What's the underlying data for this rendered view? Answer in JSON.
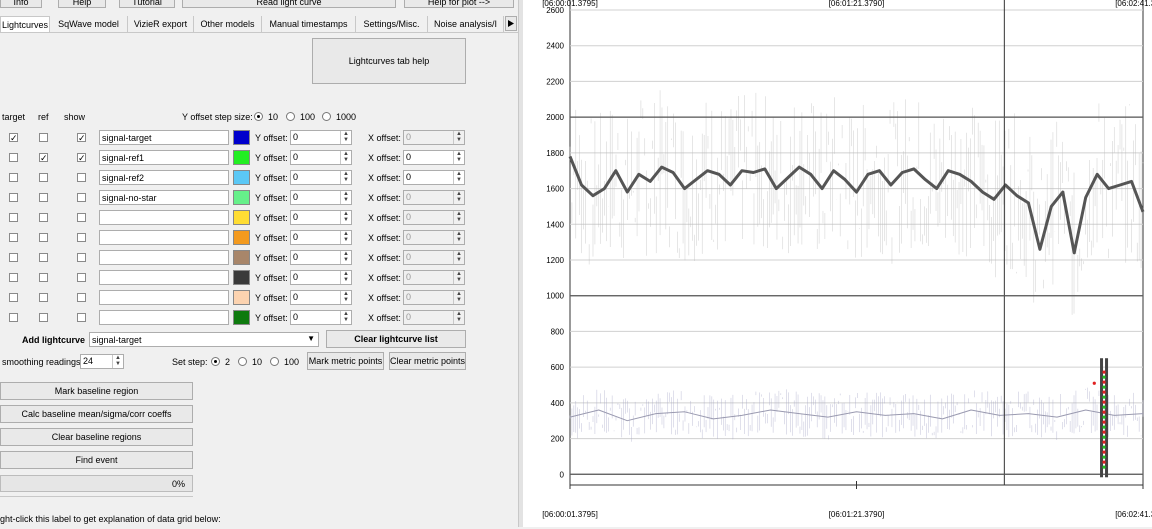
{
  "toolbar": {
    "info_label": "Info",
    "help_label": "Help",
    "tutorial_label": "Tutorial",
    "read_lc_label": "Read light curve",
    "help_plot_label": "Help for plot -->"
  },
  "tabs": [
    {
      "label": "Lightcurves"
    },
    {
      "label": "SqWave model"
    },
    {
      "label": "VizieR export"
    },
    {
      "label": "Other models"
    },
    {
      "label": "Manual timestamps"
    },
    {
      "label": "Settings/Misc."
    },
    {
      "label": "Noise analysis/I"
    }
  ],
  "tab_scroll_icon": "triangle-right-icon",
  "help_button_label": "Lightcurves tab help",
  "columns": {
    "target": "target",
    "ref": "ref",
    "show": "show"
  },
  "yoffset_step": {
    "label": "Y offset step size:",
    "options": [
      "10",
      "100",
      "1000"
    ],
    "selected": "10"
  },
  "rows": [
    {
      "target": true,
      "ref": false,
      "show": true,
      "name": "signal-target",
      "color": "#0000cc",
      "yoffset_label": "Y offset:",
      "yoffset": "0",
      "xoffset_label": "X offset:",
      "xoffset": "0",
      "x_enabled": false
    },
    {
      "target": false,
      "ref": true,
      "show": true,
      "name": "signal-ref1",
      "color": "#22ee22",
      "yoffset_label": "Y offset:",
      "yoffset": "0",
      "xoffset_label": "X offset:",
      "xoffset": "0",
      "x_enabled": true
    },
    {
      "target": false,
      "ref": false,
      "show": false,
      "name": "signal-ref2",
      "color": "#5bc8f5",
      "yoffset_label": "Y offset:",
      "yoffset": "0",
      "xoffset_label": "X offset:",
      "xoffset": "0",
      "x_enabled": true
    },
    {
      "target": false,
      "ref": false,
      "show": false,
      "name": "signal-no-star",
      "color": "#66f08a",
      "yoffset_label": "Y offset:",
      "yoffset": "0",
      "xoffset_label": "X offset:",
      "xoffset": "0",
      "x_enabled": false
    },
    {
      "target": false,
      "ref": false,
      "show": false,
      "name": "",
      "color": "#ffdd33",
      "yoffset_label": "Y offset:",
      "yoffset": "0",
      "xoffset_label": "X offset:",
      "xoffset": "0",
      "x_enabled": false
    },
    {
      "target": false,
      "ref": false,
      "show": false,
      "name": "",
      "color": "#f39a1e",
      "yoffset_label": "Y offset:",
      "yoffset": "0",
      "xoffset_label": "X offset:",
      "xoffset": "0",
      "x_enabled": false
    },
    {
      "target": false,
      "ref": false,
      "show": false,
      "name": "",
      "color": "#a8866a",
      "yoffset_label": "Y offset:",
      "yoffset": "0",
      "xoffset_label": "X offset:",
      "xoffset": "0",
      "x_enabled": false
    },
    {
      "target": false,
      "ref": false,
      "show": false,
      "name": "",
      "color": "#3a3a3a",
      "yoffset_label": "Y offset:",
      "yoffset": "0",
      "xoffset_label": "X offset:",
      "xoffset": "0",
      "x_enabled": false
    },
    {
      "target": false,
      "ref": false,
      "show": false,
      "name": "",
      "color": "#fcd3b0",
      "yoffset_label": "Y offset:",
      "yoffset": "0",
      "xoffset_label": "X offset:",
      "xoffset": "0",
      "x_enabled": false
    },
    {
      "target": false,
      "ref": false,
      "show": false,
      "name": "",
      "color": "#0e7a0e",
      "yoffset_label": "Y offset:",
      "yoffset": "0",
      "xoffset_label": "X offset:",
      "xoffset": "0",
      "x_enabled": false
    }
  ],
  "add_lightcurve": {
    "label": "Add lightcurve",
    "value": "signal-target"
  },
  "clear_lc_list_label": "Clear lightcurve list",
  "smoothing": {
    "label": "smoothing readings",
    "value": "24"
  },
  "set_step": {
    "label": "Set step:",
    "options": [
      "2",
      "10",
      "100"
    ],
    "selected": "2"
  },
  "mark_metric_label": "Mark metric points",
  "clear_metric_label": "Clear metric points",
  "baseline_buttons": [
    {
      "label": "Mark baseline region"
    },
    {
      "label": "Calc baseline mean/sigma/corr coeffs"
    },
    {
      "label": "Clear baseline regions"
    },
    {
      "label": "Find event"
    }
  ],
  "progress": {
    "text": "0%",
    "value": 0
  },
  "footer_text": "ght-click this label to get explanation of data grid below:",
  "chart_data": {
    "type": "line",
    "x_tick_labels": [
      "[06:00:01.3795]",
      "[06:01:21.3790]",
      "[06:02:41.3786]"
    ],
    "y_ticks": [
      0,
      200,
      400,
      600,
      800,
      1000,
      1200,
      1400,
      1600,
      1800,
      2000,
      2200,
      2400,
      2600
    ],
    "ylim": [
      -60,
      2600
    ],
    "grid": true,
    "series": [
      {
        "color": "#555555",
        "x": [
          0,
          0.02,
          0.04,
          0.06,
          0.08,
          0.1,
          0.12,
          0.14,
          0.16,
          0.18,
          0.2,
          0.22,
          0.24,
          0.26,
          0.28,
          0.3,
          0.32,
          0.34,
          0.36,
          0.38,
          0.4,
          0.42,
          0.44,
          0.46,
          0.48,
          0.5,
          0.52,
          0.54,
          0.56,
          0.58,
          0.6,
          0.62,
          0.64,
          0.66,
          0.68,
          0.7,
          0.72,
          0.74,
          0.76,
          0.78,
          0.8,
          0.82,
          0.84,
          0.86,
          0.88,
          0.9,
          0.92,
          0.94,
          0.96,
          0.98,
          1.0
        ],
        "values": [
          1780,
          1620,
          1560,
          1600,
          1700,
          1580,
          1680,
          1640,
          1720,
          1690,
          1600,
          1650,
          1700,
          1680,
          1620,
          1700,
          1690,
          1710,
          1600,
          1660,
          1720,
          1680,
          1600,
          1700,
          1650,
          1580,
          1680,
          1700,
          1620,
          1690,
          1710,
          1650,
          1600,
          1700,
          1680,
          1640,
          1580,
          1540,
          1620,
          1560,
          1520,
          1260,
          1500,
          1580,
          1240,
          1550,
          1680,
          1600,
          1620,
          1640,
          1470
        ]
      },
      {
        "color": "#9a9ab0",
        "x": [
          0,
          0.05,
          0.1,
          0.15,
          0.2,
          0.25,
          0.3,
          0.35,
          0.4,
          0.45,
          0.5,
          0.55,
          0.6,
          0.65,
          0.7,
          0.75,
          0.8,
          0.85,
          0.9,
          0.95,
          1.0
        ],
        "values": [
          320,
          360,
          300,
          340,
          350,
          310,
          330,
          360,
          340,
          320,
          350,
          330,
          340,
          310,
          360,
          330,
          340,
          320,
          360,
          330,
          340
        ]
      }
    ],
    "overlays": [
      {
        "type": "vline",
        "x": 0.758,
        "color": "#333333"
      },
      {
        "type": "hline",
        "y": 2000,
        "color": "#555555"
      },
      {
        "type": "hline",
        "y": 1000,
        "color": "#555555"
      },
      {
        "type": "hline",
        "y": 0,
        "color": "#555555"
      }
    ]
  }
}
